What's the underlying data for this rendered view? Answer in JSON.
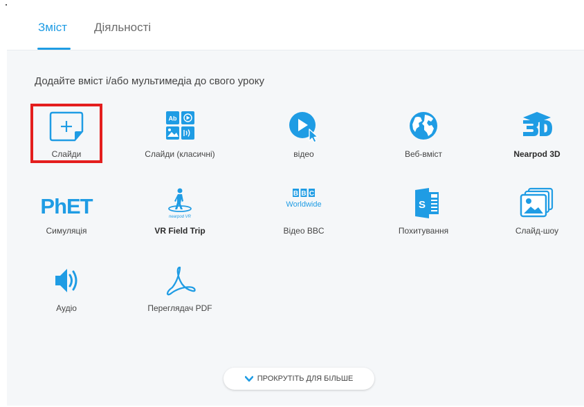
{
  "tabs": [
    {
      "label": "Зміст"
    },
    {
      "label": "Діяльності"
    }
  ],
  "intro": "Додайте вміст і/або мультимедіа до свого уроку",
  "items": [
    {
      "label": "Слайди",
      "icon": "add-slide-icon"
    },
    {
      "label": "Слайди (класичні)",
      "icon": "classic-slides-icon"
    },
    {
      "label": "відео",
      "icon": "video-play-icon"
    },
    {
      "label": "Веб-вміст",
      "icon": "globe-icon"
    },
    {
      "label": "Nearpod 3D",
      "icon": "nearpod-3d-icon"
    },
    {
      "label": "Симуляція",
      "icon": "phet-logo-icon",
      "logo_text": "PhET"
    },
    {
      "label": "VR Field Trip",
      "icon": "vr-field-trip-icon",
      "logo_text": "nearpod VR"
    },
    {
      "label": "Відео BBC",
      "icon": "bbc-worldwide-icon",
      "logo_text": [
        "B",
        "B",
        "C",
        "Worldwide"
      ]
    },
    {
      "label": "Похитування",
      "icon": "sway-icon"
    },
    {
      "label": "Слайд-шоу",
      "icon": "slideshow-icon"
    },
    {
      "label": "Аудіо",
      "icon": "audio-speaker-icon"
    },
    {
      "label": "Переглядач PDF",
      "icon": "pdf-viewer-icon"
    }
  ],
  "scroll_more": "ПРОКРУТІТЬ ДЛЯ БІЛЬШЕ",
  "colors": {
    "accent": "#1f9ce4",
    "highlight": "#e41e1e",
    "panel_bg": "#f5f7f9"
  }
}
